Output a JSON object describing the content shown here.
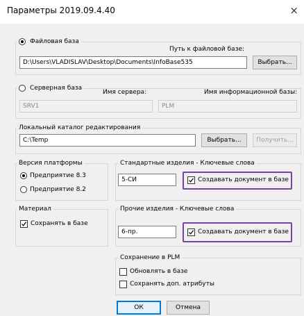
{
  "window": {
    "title": "Параметры   2019.09.4.40",
    "close_glyph": "×"
  },
  "file_base": {
    "radio_label": "Файловая база",
    "path_label": "Путь к файловой базе:",
    "path_value": "D:\\Users\\VLADISLAV\\Desktop\\Documents\\InfoBase535",
    "browse_label": "Выбрать...",
    "selected": true
  },
  "server_base": {
    "radio_label": "Серверная база",
    "server_name_label": "Имя сервера:",
    "infobase_name_label": "Имя информационной базы:",
    "server_value": "SRV1",
    "infobase_value": "PLM",
    "selected": false
  },
  "local_catalog": {
    "legend": "Локальный каталог редактирования",
    "path_value": "C:\\Temp",
    "browse_label": "Выбрать...",
    "get_label": "Получить..."
  },
  "platform": {
    "legend": "Версия платформы",
    "options": [
      "Предприятие 8.3",
      "Предприятие 8.2"
    ],
    "selected_index": 0
  },
  "standard_parts": {
    "legend": "Стандартные изделия - Ключевые слова",
    "keyword_value": "5-СИ",
    "checkbox_label": "Создавать документ в базе",
    "checked": true
  },
  "material": {
    "legend": "Материал",
    "checkbox_label": "Сохранять в базе",
    "checked": true
  },
  "other_parts": {
    "legend": "Прочие изделия - Ключевые слова",
    "keyword_value": "6-пр.",
    "checkbox_label": "Создавать документ в базе",
    "checked": true
  },
  "plm_save": {
    "legend": "Сохранение в PLM",
    "options": [
      "Обновлять в базе",
      "Сохранять доп. атрибуты"
    ],
    "checked": [
      false,
      false
    ]
  },
  "footer": {
    "ok_label": "ОК",
    "cancel_label": "Отмена"
  },
  "colors": {
    "highlight": "#7b3fa8",
    "focus": "#0078d7"
  }
}
